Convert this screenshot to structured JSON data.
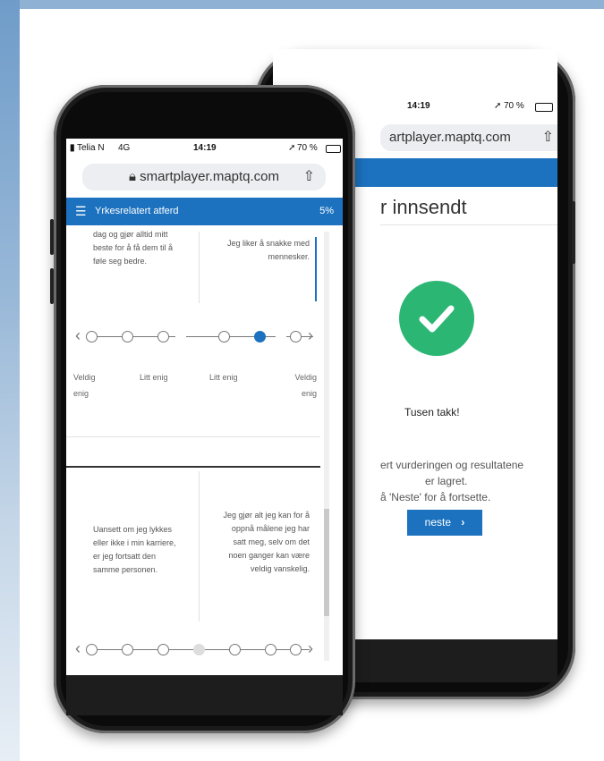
{
  "back_phone": {
    "status": {
      "time": "14:19",
      "battery": "70 %"
    },
    "url": "artplayer.maptq.com",
    "title": "r innsendt",
    "thanks": "Tusen takk!",
    "lines": [
      "ert vurderingen og resultatene",
      "er lagret.",
      "å 'Neste' for å fortsette."
    ],
    "button_label": "neste"
  },
  "front_phone": {
    "status": {
      "carrier": "Telia N",
      "network": "4G",
      "time": "14:19",
      "battery": "70 %"
    },
    "url": "smartplayer.maptq.com",
    "bar": {
      "title": "Yrkesrelatert atferd",
      "progress": "5%"
    },
    "question1": {
      "left": "dag og gjør alltid mitt beste for å få dem til å føle seg bedre.",
      "right": "Jeg liker å snakke med mennesker.",
      "selected_index": 4,
      "scale": [
        "Veldig enig",
        "Litt enig",
        "Litt enig",
        "Veldig enig"
      ]
    },
    "question2": {
      "left": "Uansett om jeg lykkes eller ikke i min karriere, er jeg fortsatt den samme personen.",
      "right": "Jeg gjør alt jeg kan for å oppnå målene jeg har satt meg, selv om det noen ganger kan være veldig vanskelig."
    }
  }
}
